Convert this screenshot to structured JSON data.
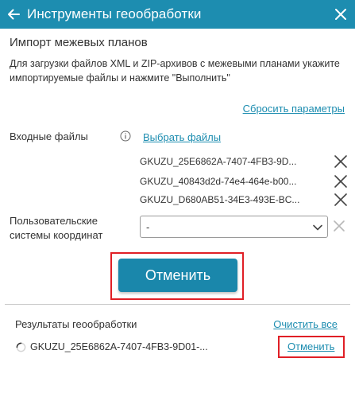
{
  "window": {
    "title": "Инструменты геообработки",
    "header_color": "#1d8db0"
  },
  "tool": {
    "title": "Импорт межевых планов",
    "description": "Для загрузки файлов XML и ZIP-архивов с межевыми планами укажите импортируемые файлы и нажмите \"Выполнить\"",
    "reset_label": "Сбросить параметры"
  },
  "input_files": {
    "label": "Входные файлы",
    "choose_label": "Выбрать файлы",
    "files": [
      "GKUZU_25E6862A-7407-4FB3-9D...",
      "GKUZU_40843d2d-74e4-464e-b00...",
      "GKUZU_D680AB51-34E3-493E-BC..."
    ]
  },
  "crs": {
    "label_line1": "Пользовательские",
    "label_line2": "системы координат",
    "selected": "-"
  },
  "action": {
    "cancel_label": "Отменить",
    "highlight_color": "#e01f26"
  },
  "results": {
    "title": "Результаты геообработки",
    "clear_all_label": "Очистить все",
    "items": [
      {
        "name": "GKUZU_25E6862A-7407-4FB3-9D01-...",
        "cancel_label": "Отменить"
      }
    ]
  }
}
